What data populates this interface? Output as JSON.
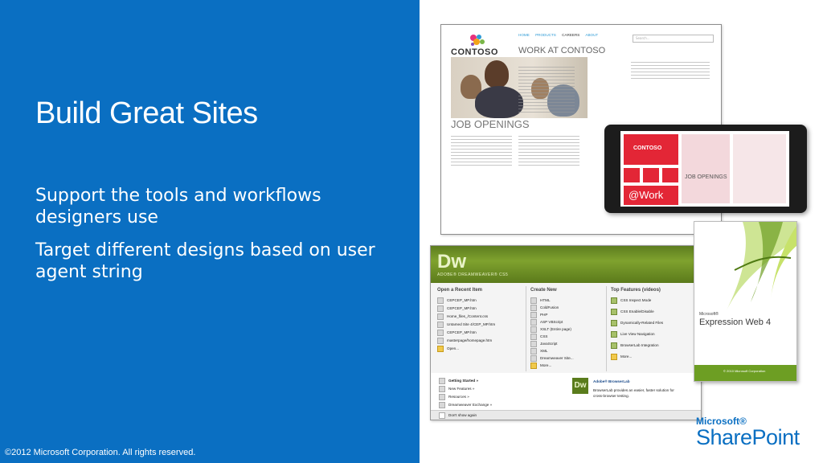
{
  "slide": {
    "title": "Build Great Sites",
    "bullets": [
      "Support the tools and workflows designers use",
      "Target different designs based on user agent string"
    ],
    "copyright": "©2012 Microsoft Corporation. All rights reserved.",
    "brand_prefix": "Microsoft®",
    "brand_name": "SharePoint",
    "accent_color": "#0a6fc2"
  },
  "contoso_site": {
    "logo": "CONTOSO",
    "nav": [
      "HOME",
      "PRODUCTS",
      "CAREERS",
      "ABOUT"
    ],
    "search_placeholder": "Search...",
    "heading": "WORK AT CONTOSO",
    "section": "JOB OPENINGS"
  },
  "phone": {
    "logo": "CONTOSO",
    "jobs": "JOB OPENINGS",
    "tile_text": "@Work"
  },
  "dreamweaver": {
    "logo": "Dw",
    "product": "ADOBE® DREAMWEAVER® CS5",
    "col_recent": "Open a Recent Item",
    "col_create": "Create New",
    "col_features": "Top Features (videos)",
    "recent": [
      "CEPCEP_MP.htm",
      "CEPCEP_MP.htm",
      "Home_files_/Content.css",
      "Untamed Site 4/CEP_MP.htm",
      "CEPCEP_MP.htm",
      "masterpage/homepage.htm",
      "Open..."
    ],
    "create": [
      "HTML",
      "ColdFusion",
      "PHP",
      "ASP VBScript",
      "XSLT (Entire page)",
      "CSS",
      "JavaScript",
      "XML",
      "Dreamweaver Site...",
      "More..."
    ],
    "features": [
      "CSS Inspect Mode",
      "CSS Enable/Disable",
      "Dynamically-Related Files",
      "Live View Navigation",
      "BrowserLab Integration",
      "More..."
    ],
    "links": [
      "Getting Started »",
      "New Features »",
      "Resources »",
      "Dreamweaver Exchange »"
    ],
    "browserlab_title": "Adobe® BrowserLab",
    "browserlab_text": "BrowserLab provides an easier, faster solution for cross-browser testing.",
    "dont_show": "Don't show again"
  },
  "expression_web": {
    "company": "Microsoft®",
    "product": "Expression Web 4",
    "footer": "© 2010 Microsoft Corporation"
  }
}
